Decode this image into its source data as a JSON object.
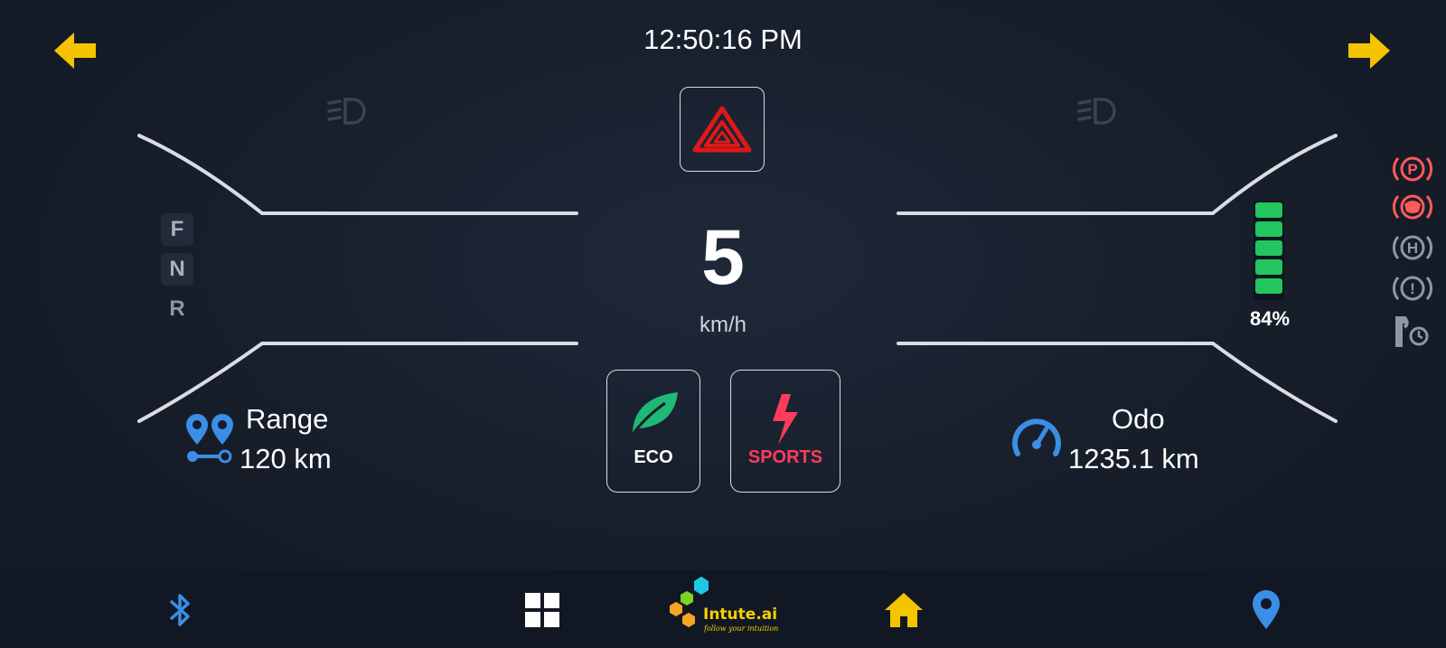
{
  "header": {
    "time": "12:50:16 PM"
  },
  "gears": [
    "F",
    "N",
    "R"
  ],
  "speed": {
    "value": "5",
    "unit": "km/h"
  },
  "battery": {
    "percent_label": "84%",
    "level": 0.84,
    "color": "#22c55e"
  },
  "modes": [
    {
      "label": "ECO",
      "color": "#ffffff",
      "icon": "leaf-icon"
    },
    {
      "label": "SPORTS",
      "color": "#ff3b5c",
      "icon": "lightning-icon"
    }
  ],
  "range": {
    "label": "Range",
    "value": "120 km"
  },
  "odo": {
    "label": "Odo",
    "value": "1235.1 km"
  },
  "logo": {
    "text": "Intute.ai",
    "tagline": "follow your intuition"
  },
  "colors": {
    "accent_yellow": "#f5c400",
    "hazard_red": "#e01818",
    "icon_blue": "#3b8ee6",
    "warning_red": "#ff5a5a"
  },
  "warning_icons": [
    "parking-brake-icon",
    "brake-warning-icon",
    "hold-icon",
    "general-warning-icon",
    "service-icon"
  ],
  "nav_icons": [
    "bluetooth-icon",
    "apps-grid-icon",
    "home-icon",
    "location-pin-icon"
  ]
}
